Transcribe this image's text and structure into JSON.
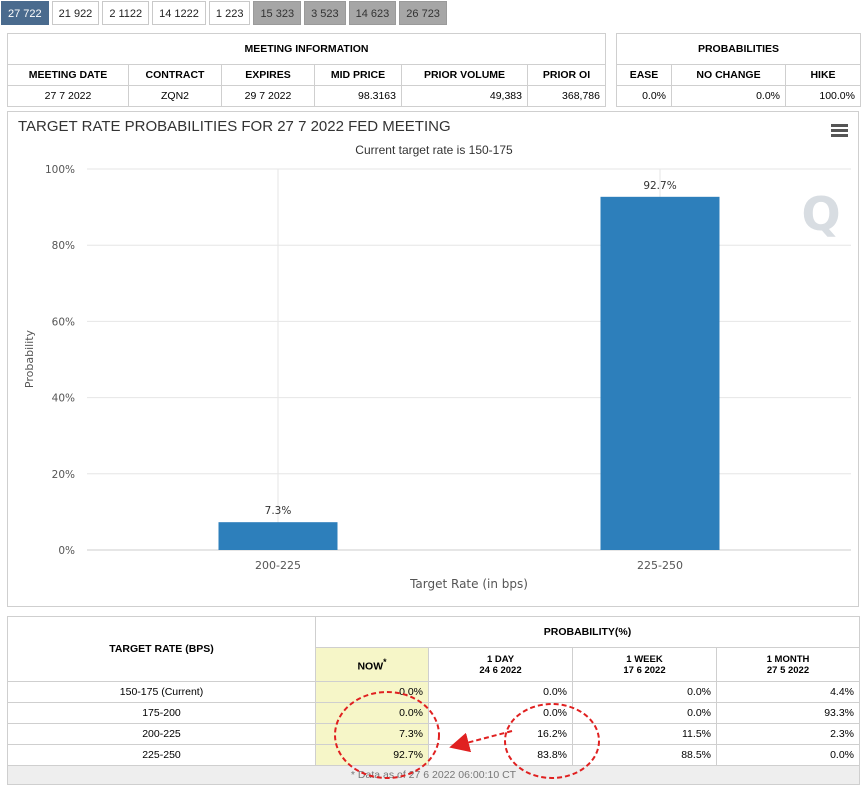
{
  "tabs": [
    "27 722",
    "21 922",
    "2 1122",
    "14 1222",
    "1 223",
    "15 323",
    "3 523",
    "14 623",
    "26 723"
  ],
  "meeting_info": {
    "title": "MEETING INFORMATION",
    "headers": [
      "MEETING DATE",
      "CONTRACT",
      "EXPIRES",
      "MID PRICE",
      "PRIOR VOLUME",
      "PRIOR OI"
    ],
    "row": [
      "27 7 2022",
      "ZQN2",
      "29 7 2022",
      "98.3163",
      "49,383",
      "368,786"
    ]
  },
  "probabilities": {
    "title": "PROBABILITIES",
    "headers": [
      "EASE",
      "NO CHANGE",
      "HIKE"
    ],
    "row": [
      "0.0%",
      "0.0%",
      "100.0%"
    ]
  },
  "chart_data": {
    "type": "bar",
    "title": "TARGET RATE PROBABILITIES FOR 27 7 2022 FED MEETING",
    "subtitle": "Current target rate is 150-175",
    "categories": [
      "200-225",
      "225-250"
    ],
    "values": [
      7.3,
      92.7
    ],
    "data_labels": [
      "7.3%",
      "92.7%"
    ],
    "xlabel": "Target Rate (in bps)",
    "ylabel": "Probability",
    "ylim": [
      0,
      100
    ],
    "yticks": [
      "0%",
      "20%",
      "40%",
      "60%",
      "80%",
      "100%"
    ],
    "bar_color": "#2d7fbb",
    "grid": true,
    "watermark": "Q"
  },
  "prob_table": {
    "col1_header": "TARGET RATE (BPS)",
    "group_header": "PROBABILITY(%)",
    "cols": [
      {
        "label": "NOW",
        "sub": ""
      },
      {
        "label": "1 DAY",
        "sub": "24 6 2022"
      },
      {
        "label": "1 WEEK",
        "sub": "17 6 2022"
      },
      {
        "label": "1 MONTH",
        "sub": "27 5 2022"
      }
    ],
    "now_marker": "*",
    "rows": [
      {
        "rate": "150-175 (Current)",
        "vals": [
          "0.0%",
          "0.0%",
          "0.0%",
          "4.4%"
        ]
      },
      {
        "rate": "175-200",
        "vals": [
          "0.0%",
          "0.0%",
          "0.0%",
          "93.3%"
        ]
      },
      {
        "rate": "200-225",
        "vals": [
          "7.3%",
          "16.2%",
          "11.5%",
          "2.3%"
        ]
      },
      {
        "rate": "225-250",
        "vals": [
          "92.7%",
          "83.8%",
          "88.5%",
          "0.0%"
        ]
      }
    ],
    "footer": "* Data as of 27 6 2022 06:00:10 CT"
  }
}
